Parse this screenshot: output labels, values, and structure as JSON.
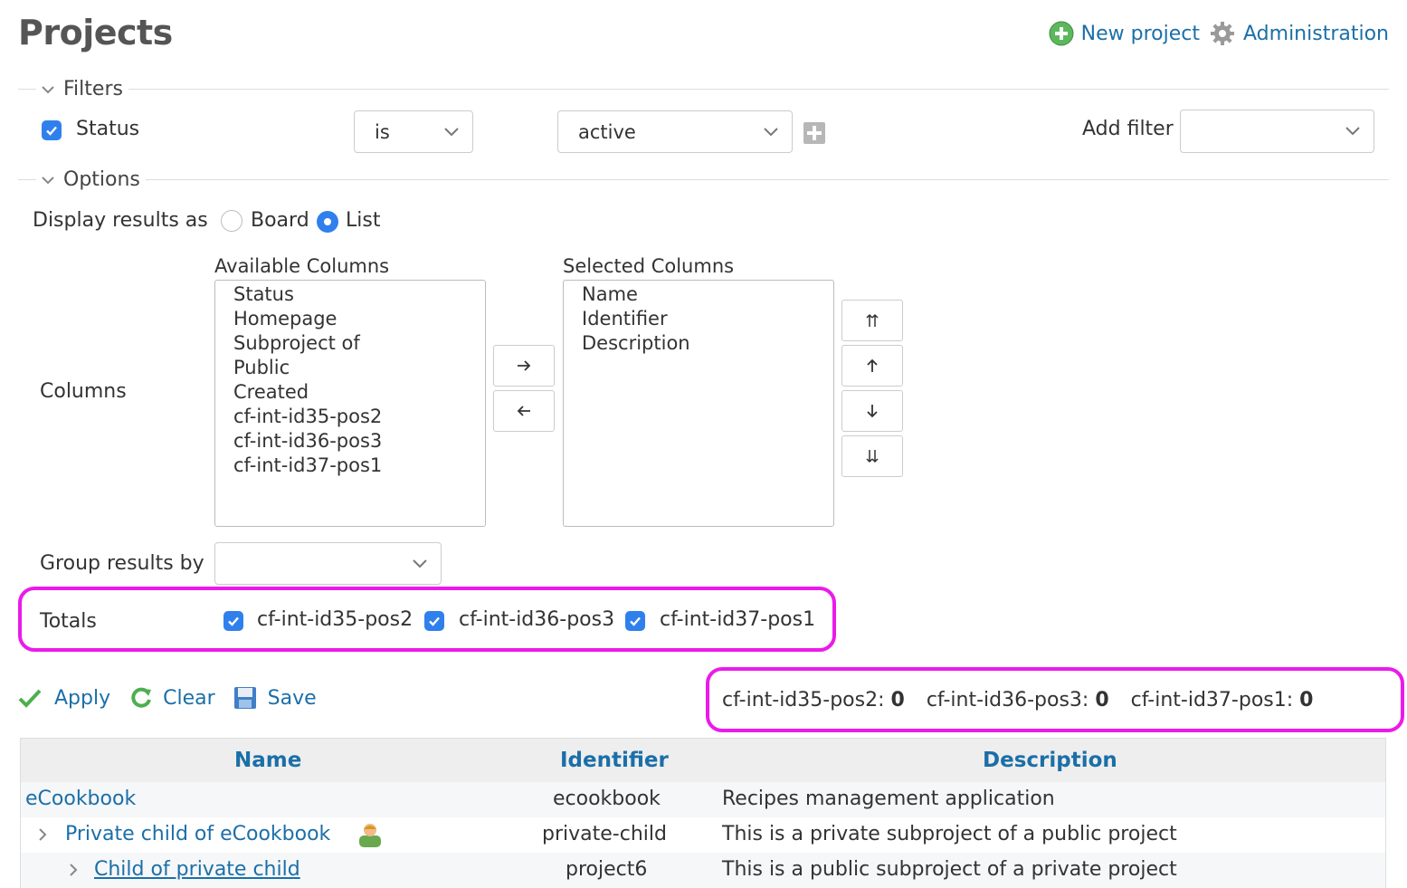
{
  "page": {
    "title": "Projects"
  },
  "top_links": {
    "new_project": "New project",
    "administration": "Administration"
  },
  "filters": {
    "legend": "Filters",
    "status_label": "Status",
    "operator": "is",
    "value": "active",
    "add_filter_label": "Add filter",
    "add_filter_value": ""
  },
  "options": {
    "legend": "Options",
    "display_label": "Display results as",
    "board_label": "Board",
    "list_label": "List",
    "columns_label": "Columns",
    "available_title": "Available Columns",
    "available": [
      "Status",
      "Homepage",
      "Subproject of",
      "Public",
      "Created",
      "cf-int-id35-pos2",
      "cf-int-id36-pos3",
      "cf-int-id37-pos1"
    ],
    "selected_title": "Selected Columns",
    "selected": [
      "Name",
      "Identifier",
      "Description"
    ],
    "group_label": "Group results by",
    "group_value": "",
    "totals_label": "Totals",
    "totals": [
      "cf-int-id35-pos2",
      "cf-int-id36-pos3",
      "cf-int-id37-pos1"
    ]
  },
  "actions": {
    "apply": "Apply",
    "clear": "Clear",
    "save": "Save"
  },
  "totals_summary": [
    {
      "label": "cf-int-id35-pos2:",
      "value": "0"
    },
    {
      "label": "cf-int-id36-pos3:",
      "value": "0"
    },
    {
      "label": "cf-int-id37-pos1:",
      "value": "0"
    }
  ],
  "table": {
    "headers": {
      "name": "Name",
      "identifier": "Identifier",
      "description": "Description"
    },
    "rows": [
      {
        "name": "eCookbook",
        "identifier": "ecookbook",
        "description": "Recipes management application"
      },
      {
        "name": "Private child of eCookbook",
        "identifier": "private-child",
        "description": "This is a private subproject of a public project"
      },
      {
        "name": "Child of private child",
        "identifier": "project6",
        "description": "This is a public subproject of a private project"
      }
    ]
  },
  "colors": {
    "link": "#1b6fa8",
    "checkbox": "#2f80ed",
    "highlight": "#ea1bea"
  }
}
